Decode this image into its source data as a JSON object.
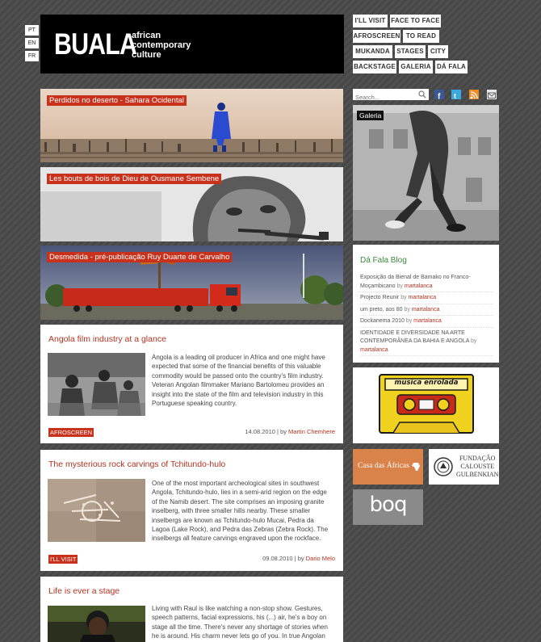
{
  "languages": [
    "PT",
    "EN",
    "FR"
  ],
  "logo": {
    "name": "BUALA",
    "tagline": [
      "african",
      "contemporary",
      "culture"
    ]
  },
  "nav": [
    "I'LL VISIT",
    "FACE TO FACE",
    "AFROSCREEN",
    "TO READ",
    "MUKANDA",
    "STAGES",
    "CITY",
    "BACKSTAGE",
    "GALERIA",
    "DÁ FALA"
  ],
  "features": [
    {
      "title": "Perdidos no deserto - Sahara Ocidental"
    },
    {
      "title": "Les bouts de bois de Dieu de Ousmane Sembene"
    },
    {
      "title": "Desmedida - pré-publicação Ruy Duarte de Carvalho"
    }
  ],
  "posts": [
    {
      "title": "Angola film industry at a glance",
      "text": "Angola is a leading oil producer in Africa and one might have expected that some of the financial benefits of this valuable commodity would be passed onto the country's film industry. Veteran Angolan filmmaker Mariano Bartolomeu provides an insight into the state of the film and television industry in this Portuguese speaking country.",
      "tag": "AFROSCREEN",
      "date": "14.08.2010 | by ",
      "author": "Martin Chemhere"
    },
    {
      "title": "The mysterious rock carvings of Tchitundo-hulo",
      "text": "One of the most important archeological sites in southwest Angola, Tchitundo-hulo, lies in a semi-arid region on the edge of the Namib desert. The site comprises an imposing granite inselberg, with three smaller hills nearby. These smaller inselbergs are known as Tchitundo-hulo Mucai, Pedra da Lagoa (Lake Rock), and Pedra das Zebras (Zebra Rock). The inselbergs all feature carvings engraved upon the rockface.",
      "tag": "I'LL VISIT",
      "date": "09.08.2010 | by ",
      "author": "Dario Melo"
    },
    {
      "title": "Life is ever a stage",
      "text": "Living with Raul is like watching a non-stop show. Gestures, speech patterns, facial expressions, his (...) air, he's a boy on stage all the time. There's never any shortage of stories when he is around. His charm never lets go of you. In true Angolan"
    }
  ],
  "sidebar": {
    "search_placeholder": "Search...",
    "galeria_label": "Galeria",
    "blog": {
      "title": "Dá Fala Blog",
      "entries": [
        {
          "link": "Exposição da Bienal de Bamako no Franco-Moçambicano",
          "by": " by ",
          "author": "martalanca"
        },
        {
          "link": "Projecto Reunir",
          "by": " by ",
          "author": "martalanca"
        },
        {
          "link": "um preto, aos 80",
          "by": " by ",
          "author": "martalanca"
        },
        {
          "link": "Dockanema 2010",
          "by": " by ",
          "author": "martalanca"
        },
        {
          "link": "IDENTIDADE E DIVERSIDADE NA ARTE CONTEMPORÂNEA DA BAHIA E ANGOLA",
          "by": " by ",
          "author": "martalanca"
        }
      ]
    },
    "cassette_label": "musica enrolada",
    "casa_label": "Casa das Áfricas",
    "fundacao_label": [
      "FUNDAÇÃO",
      "CALOUSTE",
      "GULBENKIAN"
    ],
    "boq_label": "boq"
  },
  "colors": {
    "accent": "#c8321d",
    "blog_green": "#3a8a3a",
    "background": "#4a4a4a"
  }
}
